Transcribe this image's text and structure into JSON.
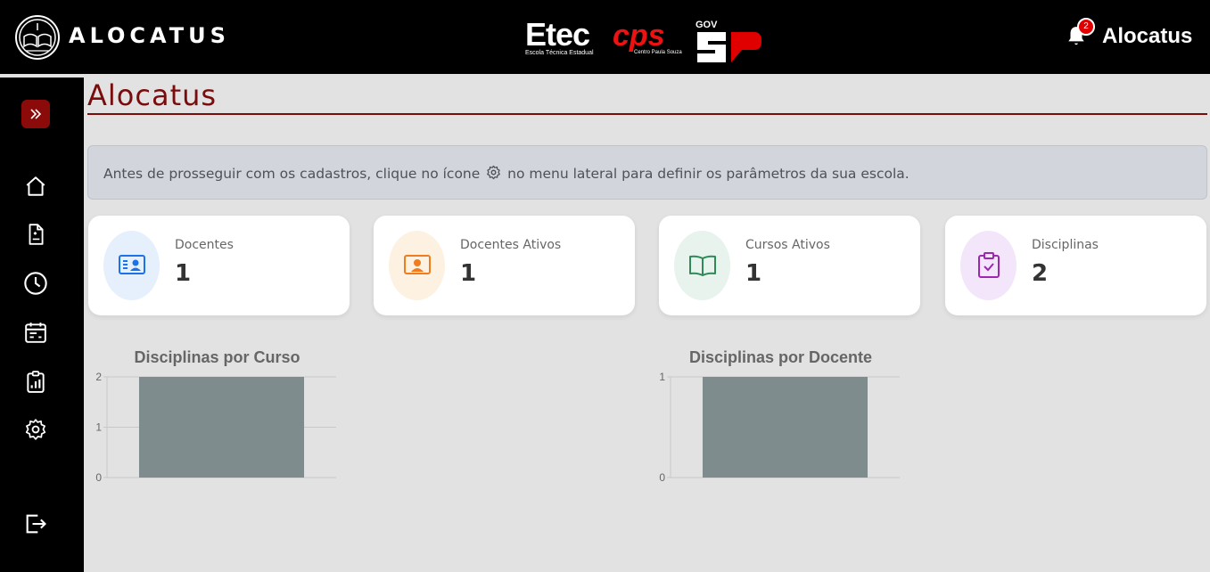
{
  "header": {
    "brand": "ALOCATUS",
    "etec_logo": "Etec",
    "etec_sub": "Escola Técnica Estadual",
    "cps_logo": "cps",
    "cps_sub": "Centro Paula Souza",
    "gov_label": "GOV",
    "notification_count": "2",
    "user_name": "Alocatus"
  },
  "sidebar": {
    "items": [
      {
        "icon": "home-icon"
      },
      {
        "icon": "document-icon"
      },
      {
        "icon": "clock-icon"
      },
      {
        "icon": "calendar-icon"
      },
      {
        "icon": "report-icon"
      },
      {
        "icon": "gear-icon"
      },
      {
        "icon": "logout-icon"
      }
    ]
  },
  "page": {
    "title": "Alocatus",
    "alert_before": "Antes de prosseguir com os cadastros, clique no ícone",
    "alert_after": "no menu lateral para definir os parâmetros da sua escola."
  },
  "cards": [
    {
      "label": "Docentes",
      "value": "1",
      "icon": "teacher-id-icon",
      "accent": "#1a73e8",
      "bg": "#e6f0fd"
    },
    {
      "label": "Docentes Ativos",
      "value": "1",
      "icon": "active-teacher-icon",
      "accent": "#f07c1e",
      "bg": "#fdf1e2"
    },
    {
      "label": "Cursos Ativos",
      "value": "1",
      "icon": "book-icon",
      "accent": "#2e8b57",
      "bg": "#e7f3ec"
    },
    {
      "label": "Disciplinas",
      "value": "2",
      "icon": "clipboard-check-icon",
      "accent": "#9c27b0",
      "bg": "#f3e6fa"
    }
  ],
  "colors": {
    "header_bg": "#000000",
    "brand_red": "#7a0c0c",
    "bar": "#7f8c8d"
  },
  "chart_data": [
    {
      "type": "bar",
      "title": "Disciplinas por Curso",
      "categories": [
        ""
      ],
      "values": [
        2
      ],
      "yticks": [
        "0",
        "1",
        "2"
      ],
      "ylim": [
        0,
        2
      ],
      "grid": true
    },
    {
      "type": "bar",
      "title": "Disciplinas por Docente",
      "categories": [
        ""
      ],
      "values": [
        1
      ],
      "yticks": [
        "0",
        "1"
      ],
      "ylim": [
        0,
        1
      ],
      "grid": true
    }
  ]
}
